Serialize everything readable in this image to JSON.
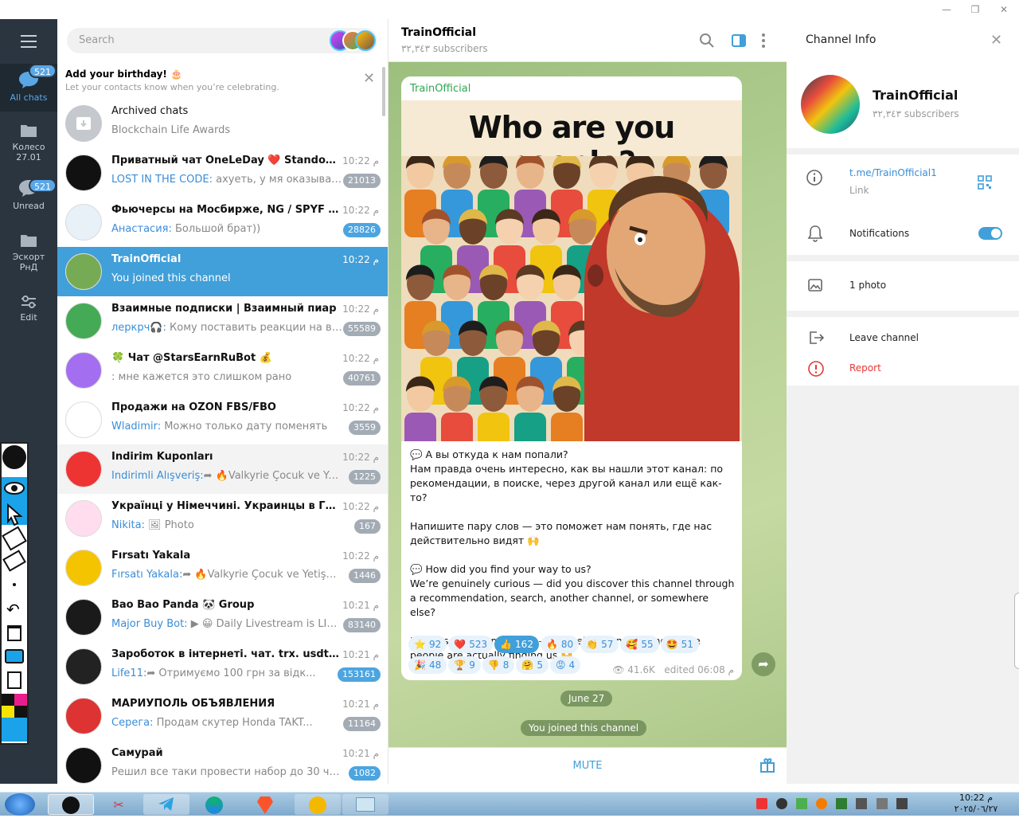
{
  "window": {
    "min": "—",
    "restore": "❐",
    "close": "✕"
  },
  "rail": {
    "all_chats": {
      "label": "All chats",
      "badge": "521"
    },
    "folder1": {
      "label": "Колесо\n27.01"
    },
    "unread": {
      "label": "Unread",
      "badge": "521"
    },
    "folder2": {
      "label": "Эскорт\nРнД"
    },
    "edit": {
      "label": "Edit"
    }
  },
  "search": {
    "placeholder": "Search"
  },
  "birthday": {
    "title": "Add your birthday! 🎂",
    "subtitle": "Let your contacts know when you’re celebrating."
  },
  "archived": {
    "title": "Archived chats",
    "subtitle": "Blockchain Life Awards"
  },
  "chats": [
    {
      "name": "Приватный чат OneLeDay ❤️ Standoff...",
      "time": "10:22 م",
      "sender": "LOST IN THE CODE:",
      "preview": " ахуеть, у мя оказывается ...",
      "count": "21013",
      "blue": false
    },
    {
      "name": "Фьючерсы на Мосбирже, NG / SPYF / NA...",
      "time": "10:22 م",
      "sender": "Анастасия:",
      "preview": " Большой брат))",
      "count": "28826",
      "blue": true
    },
    {
      "name": "TrainOfficial",
      "time": "10:22 م",
      "sender": "",
      "preview": "You joined this channel",
      "count": "",
      "blue": false
    },
    {
      "name": "Взаимные подписки | Взаимный пиар",
      "time": "10:22 م",
      "sender": "леркрч🎧:",
      "preview": " Кому поставить реакции на все п...",
      "count": "55589",
      "blue": false
    },
    {
      "name": "🍀 Чат @StarsEarnRuBot 💰",
      "time": "10:22 م",
      "sender": "",
      "preview": ": мне кажется это слишком рано",
      "count": "40761",
      "blue": false
    },
    {
      "name": "Продажи на OZON FBS/FBO",
      "time": "10:22 م",
      "sender": "Wladimir:",
      "preview": " Можно только дату поменять",
      "count": "3559",
      "blue": false
    },
    {
      "name": "İndirim Kuponları",
      "time": "10:22 م",
      "sender": "İndirimli Alışveriş:",
      "preview": "➦ 🔥Valkyrie Çocuk ve Ye...",
      "count": "1225",
      "blue": false
    },
    {
      "name": "Українці у Німеччині. Украинцы в Герм...",
      "time": "10:22 م",
      "sender": "Nikita:",
      "preview": " 🖼 Photo",
      "count": "167",
      "blue": false
    },
    {
      "name": "Fırsatı Yakala",
      "time": "10:22 م",
      "sender": "Fırsatı Yakala:",
      "preview": "➦ 🔥Valkyrie Çocuk ve Yetişki...",
      "count": "1446",
      "blue": false
    },
    {
      "name": "Bao Bao Panda 🐼 Group",
      "time": "10:21 م",
      "sender": "Major Buy Bot:",
      "preview": " ▶ 😀 Daily Livestream is LIVE!...",
      "count": "83140",
      "blue": false
    },
    {
      "name": "Зароботок в інтернеті. чат. trx. usdt. ве...",
      "time": "10:21 م",
      "sender": "Life11:",
      "preview": "➦ Отримуємо 100 грн за відк...",
      "count": "153161",
      "blue": true
    },
    {
      "name": "МАРИУПОЛЬ ОБЪЯВЛЕНИЯ",
      "time": "10:21 م",
      "sender": "Серега:",
      "preview": " Продам скутер Honda TAKT...",
      "count": "11164",
      "blue": false
    },
    {
      "name": "Самурай",
      "time": "10:21 م",
      "sender": "",
      "preview": "Решил все таки провести набор до 30 чел...",
      "count": "1082",
      "blue": true
    }
  ],
  "header": {
    "title": "TrainOfficial",
    "subtitle": "٣٢,٣٤٣ subscribers"
  },
  "post": {
    "channel": "TrainOfficial",
    "image_title": "Who are you people?",
    "text_ru_1": "💬 А вы откуда к нам попали?",
    "text_ru_2": "Нам правда очень интересно, как вы нашли этот канал: по рекомендации, в поиске, через другой канал или ещё как-то?",
    "text_ru_3": "Напишите пару слов — это поможет нам понять, где нас действительно видят 🙌",
    "text_en_1": "💬 How did you find your way to us?",
    "text_en_2": "We’re genuinely curious — did you discover this channel through a recommendation, search, another channel, or somewhere else?",
    "text_en_3": "Drop us a quick message — it’ll help us understand where people are actually finding us 🙌",
    "reactions": [
      {
        "e": "⭐",
        "n": "92",
        "me": false
      },
      {
        "e": "❤️",
        "n": "523",
        "me": false
      },
      {
        "e": "👍",
        "n": "162",
        "me": true
      },
      {
        "e": "🔥",
        "n": "80",
        "me": false
      },
      {
        "e": "👏",
        "n": "57",
        "me": false
      },
      {
        "e": "🥰",
        "n": "55",
        "me": false
      },
      {
        "e": "🤩",
        "n": "51",
        "me": false
      },
      {
        "e": "🎉",
        "n": "48",
        "me": false
      },
      {
        "e": "🏆",
        "n": "9",
        "me": false
      },
      {
        "e": "👎",
        "n": "8",
        "me": false
      },
      {
        "e": "🤗",
        "n": "5",
        "me": false
      },
      {
        "e": "😡",
        "n": "4",
        "me": false
      }
    ],
    "views": "41.6K",
    "edited": "edited 06:08 م"
  },
  "service": {
    "date": "June 27",
    "joined": "You joined this channel"
  },
  "bottom": {
    "mute": "MUTE"
  },
  "info": {
    "heading": "Channel Info",
    "name": "TrainOfficial",
    "subs": "٣٢,٣٤٣ subscribers",
    "link": "t.me/TrainOfficial1",
    "link_label": "Link",
    "notifications": "Notifications",
    "photos": "1 photo",
    "leave": "Leave channel",
    "report": "Report"
  },
  "tray": {
    "time": "10:22 م",
    "date": "٢٠٢٥/٠٦/٢٧"
  },
  "colors": {
    "accent": "#419fd9",
    "rail": "#2a3540",
    "wall": "#b4cf93",
    "report": "#e53935"
  }
}
